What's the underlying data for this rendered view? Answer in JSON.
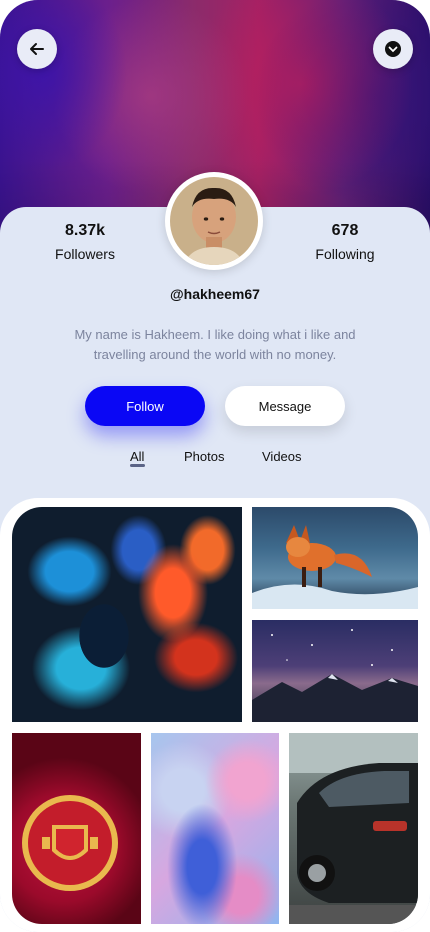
{
  "profile": {
    "followers_count": "8.37k",
    "followers_label": "Followers",
    "following_count": "678",
    "following_label": "Following",
    "handle": "@hakheem67",
    "bio": "My name is Hakheem. I like doing what i like and travelling around the world with no money."
  },
  "actions": {
    "follow_label": "Follow",
    "message_label": "Message"
  },
  "tabs": [
    {
      "label": "All",
      "active": true
    },
    {
      "label": "Photos",
      "active": false
    },
    {
      "label": "Videos",
      "active": false
    }
  ],
  "icons": {
    "back": "arrow-left-icon",
    "menu": "chevron-down-icon"
  },
  "gallery": [
    {
      "name": "ink-smoke-photo"
    },
    {
      "name": "fox-photo"
    },
    {
      "name": "starry-mountains-photo"
    },
    {
      "name": "manchester-united-crest-photo"
    },
    {
      "name": "marble-paint-photo"
    },
    {
      "name": "car-photo"
    }
  ],
  "colors": {
    "accent": "#0a07f5",
    "panel": "#e0e7f5",
    "muted_text": "#7c849e"
  }
}
